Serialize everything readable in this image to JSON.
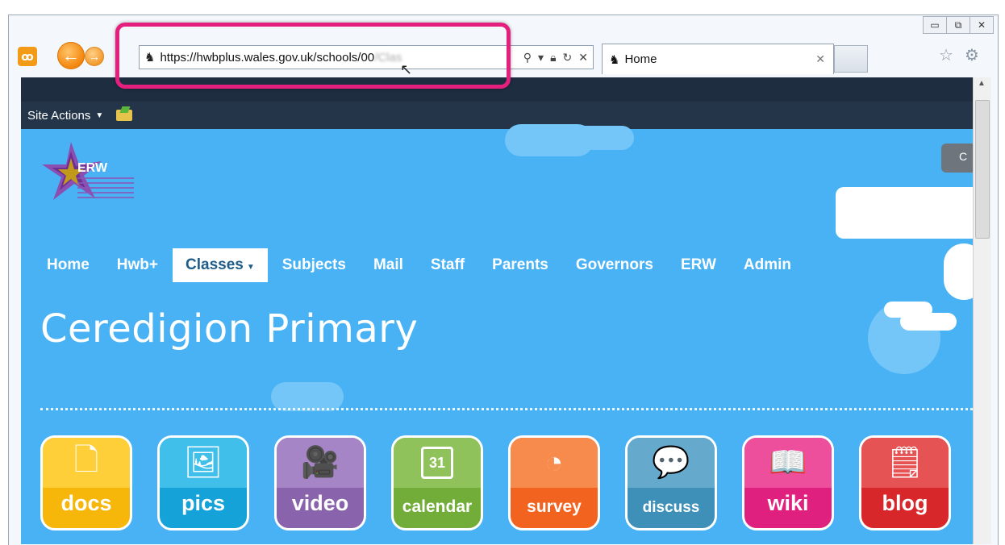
{
  "browser": {
    "address_url": "https://hwbplus.wales.gov.uk/schools/00",
    "address_url_obscured": "/Clas",
    "tab_title": "Home",
    "window_controls": [
      "minimize",
      "restore",
      "close"
    ]
  },
  "ribbon": {
    "site_actions_label": "Site Actions"
  },
  "logo": {
    "text": "ERW"
  },
  "header": {
    "grey_button_label": "C"
  },
  "nav": {
    "items": [
      {
        "label": "Home"
      },
      {
        "label": "Hwb+"
      },
      {
        "label": "Classes",
        "active": true
      },
      {
        "label": "Subjects"
      },
      {
        "label": "Mail"
      },
      {
        "label": "Staff"
      },
      {
        "label": "Parents"
      },
      {
        "label": "Governors"
      },
      {
        "label": "ERW"
      },
      {
        "label": "Admin"
      }
    ]
  },
  "page": {
    "title": "Ceredigion Primary"
  },
  "tiles": [
    {
      "label": "docs",
      "color": "#f6b60a",
      "top_color": "#ffcf3a",
      "icon": "document-icon"
    },
    {
      "label": "pics",
      "color": "#14a2d8",
      "top_color": "#3fbfe9",
      "icon": "picture-icon"
    },
    {
      "label": "video",
      "color": "#8a63ad",
      "top_color": "#a685c6",
      "icon": "video-camera-icon"
    },
    {
      "label": "calendar",
      "color": "#72ad3a",
      "top_color": "#8fc25a",
      "icon": "calendar-icon",
      "calendar_day": "31"
    },
    {
      "label": "survey",
      "color": "#f2631f",
      "top_color": "#f78a4d",
      "icon": "pie-chart-icon"
    },
    {
      "label": "discuss",
      "color": "#3f90b8",
      "top_color": "#65a9cc",
      "icon": "speech-bubble-icon"
    },
    {
      "label": "wiki",
      "color": "#e0207f",
      "top_color": "#ee4f9d",
      "icon": "open-book-icon"
    },
    {
      "label": "blog",
      "color": "#d8272a",
      "top_color": "#e65354",
      "icon": "notepad-pen-icon"
    }
  ]
}
